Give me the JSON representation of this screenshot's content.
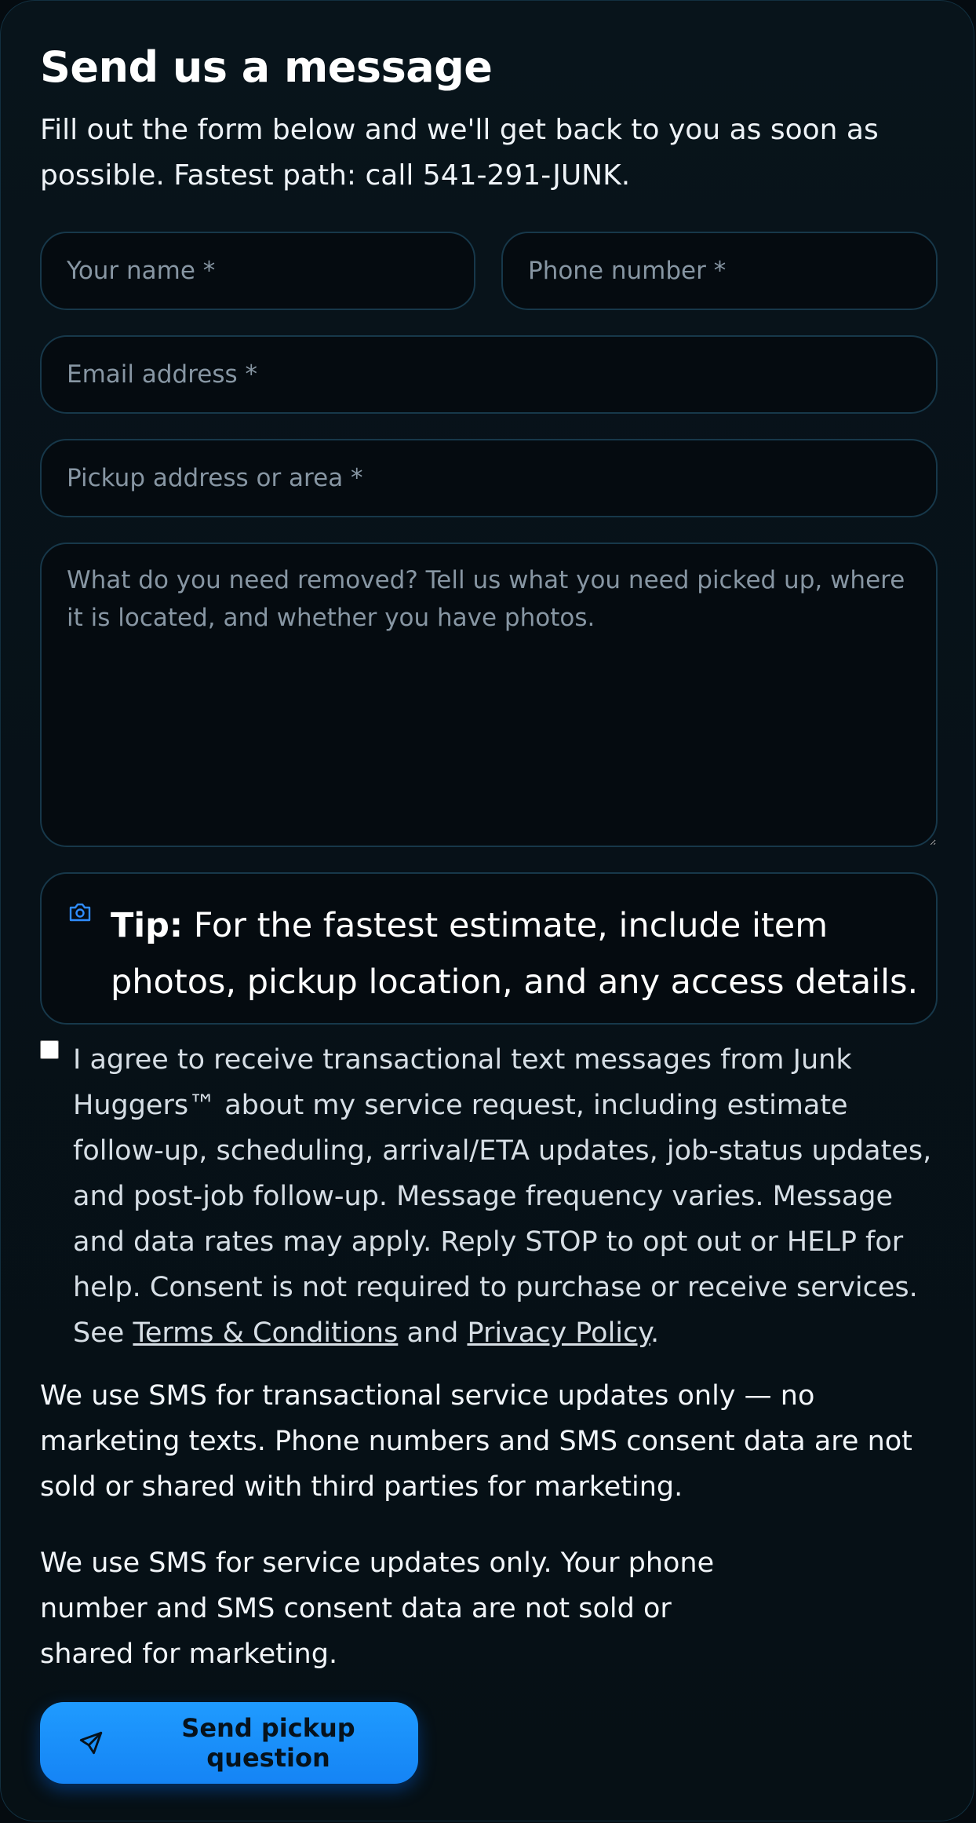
{
  "form": {
    "title": "Send us a message",
    "intro": "Fill out the form below and we'll get back to you as soon as possible. Fastest path: call 541-291-JUNK.",
    "fields": {
      "name": {
        "placeholder": "Your name *",
        "value": ""
      },
      "phone": {
        "placeholder": "Phone number *",
        "value": ""
      },
      "email": {
        "placeholder": "Email address *",
        "value": ""
      },
      "address": {
        "placeholder": "Pickup address or area *",
        "value": ""
      },
      "details": {
        "placeholder": "What do you need removed? Tell us what you need picked up, where it is located, and whether you have photos.",
        "value": ""
      }
    },
    "tip": {
      "icon": "camera-icon",
      "label": "Tip:",
      "text": "For the fastest estimate, include item photos, pickup location, and any access details."
    },
    "consent": {
      "checked": false,
      "text": "I agree to receive transactional text messages from Junk Huggers™ about my service request, including estimate follow-up, scheduling, arrival/ETA updates, job-status updates, and post-job follow-up. Message frequency varies. Message and data rates may apply. Reply STOP to opt out or HELP for help. Consent is not required to purchase or receive services. See",
      "terms_label": "Terms & Conditions",
      "and_text": "and",
      "privacy_label": "Privacy Policy",
      "end": "."
    },
    "sms_note_1": "We use SMS for transactional service updates only — no marketing texts. Phone numbers and SMS consent data are not sold or shared with third parties for marketing.",
    "sms_note_2": "We use SMS for service updates only. Your phone number and SMS consent data are not sold or shared for marketing.",
    "submit": {
      "icon": "send-icon",
      "label": "Send pickup question"
    },
    "colors": {
      "background": "#071118",
      "field_border": "#17384a",
      "accent": "#1e90ff",
      "icon_blue": "#2f8cff"
    }
  }
}
